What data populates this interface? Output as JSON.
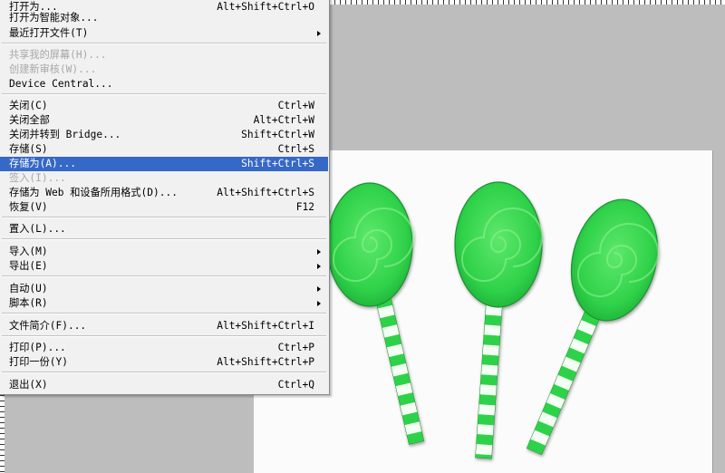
{
  "menu": {
    "items": [
      {
        "label": "打开为...",
        "shortcut": "Alt+Shift+Ctrl+O"
      },
      {
        "label": "打开为智能对象...",
        "shortcut": ""
      },
      {
        "label": "最近打开文件(T)",
        "shortcut": ""
      },
      {
        "label": "共享我的屏幕(H)...",
        "shortcut": ""
      },
      {
        "label": "创建新审核(W)...",
        "shortcut": ""
      },
      {
        "label": "Device Central...",
        "shortcut": ""
      },
      {
        "label": "关闭(C)",
        "shortcut": "Ctrl+W"
      },
      {
        "label": "关闭全部",
        "shortcut": "Alt+Ctrl+W"
      },
      {
        "label": "关闭并转到 Bridge...",
        "shortcut": "Shift+Ctrl+W"
      },
      {
        "label": "存储(S)",
        "shortcut": "Ctrl+S"
      },
      {
        "label": "存储为(A)...",
        "shortcut": "Shift+Ctrl+S"
      },
      {
        "label": "签入(I)...",
        "shortcut": ""
      },
      {
        "label": "存储为 Web 和设备所用格式(D)...",
        "shortcut": "Alt+Shift+Ctrl+S"
      },
      {
        "label": "恢复(V)",
        "shortcut": "F12"
      },
      {
        "label": "置入(L)...",
        "shortcut": ""
      },
      {
        "label": "导入(M)",
        "shortcut": ""
      },
      {
        "label": "导出(E)",
        "shortcut": ""
      },
      {
        "label": "自动(U)",
        "shortcut": ""
      },
      {
        "label": "脚本(R)",
        "shortcut": ""
      },
      {
        "label": "文件简介(F)...",
        "shortcut": "Alt+Shift+Ctrl+I"
      },
      {
        "label": "打印(P)...",
        "shortcut": "Ctrl+P"
      },
      {
        "label": "打印一份(Y)",
        "shortcut": "Alt+Shift+Ctrl+P"
      },
      {
        "label": "退出(X)",
        "shortcut": "Ctrl+Q"
      }
    ],
    "selected": "存储为(A)...",
    "disabled": [
      "共享我的屏幕(H)...",
      "创建新审核(W)...",
      "签入(I)..."
    ],
    "submenu_items": [
      "最近打开文件(T)",
      "导入(M)",
      "导出(E)",
      "自动(U)",
      "脚本(R)"
    ]
  },
  "colors": {
    "menu_bg": "#f1f1f1",
    "selection": "#3668c7",
    "workspace": "#bdbdbd",
    "lollipop_green": "#2fd24a"
  }
}
